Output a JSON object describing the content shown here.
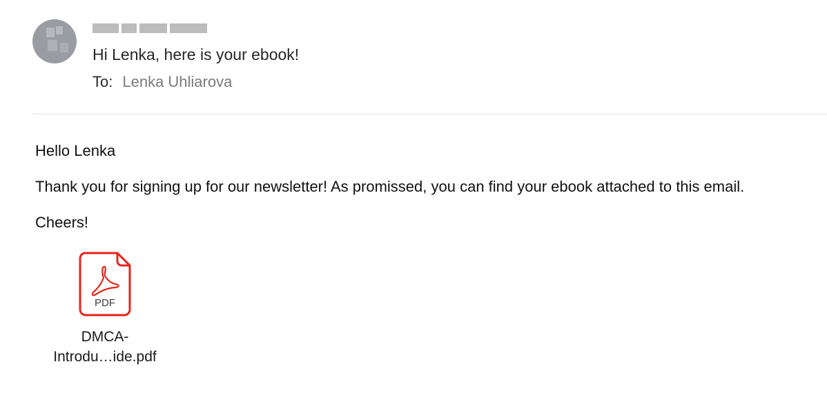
{
  "email": {
    "subject": "Hi Lenka, here is your ebook!",
    "to_label": "To:",
    "to_name": "Lenka Uhliarova"
  },
  "body": {
    "greeting": "Hello Lenka",
    "paragraph": "Thank you for signing up for our newsletter! As promissed, you can find your ebook attached to this email.",
    "signoff": "Cheers!"
  },
  "attachment": {
    "icon": "pdf-file-icon",
    "type_label": "PDF",
    "name_line1": "DMCA-",
    "name_line2": "Introdu…ide.pdf",
    "accent_color": "#e8231a"
  },
  "colors": {
    "avatar": "#9a9ca3",
    "divider": "#e2e2e2",
    "recipient": "#7b7b7b"
  }
}
